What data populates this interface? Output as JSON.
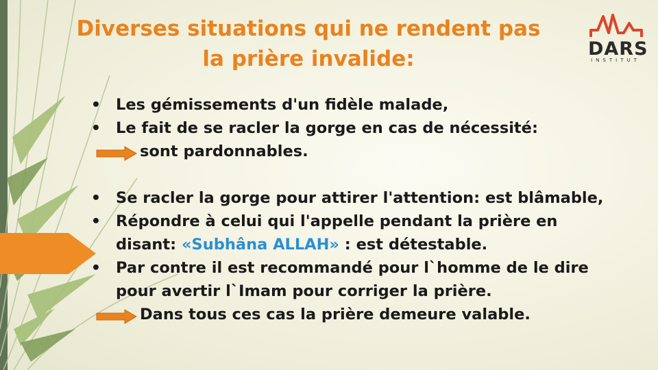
{
  "slide": {
    "title_line1": "Diverses situations qui ne rendent pas",
    "title_line2": "la prière invalide:",
    "logo": {
      "name": "DARS",
      "sub": "INSTITUT"
    },
    "colors": {
      "title": "#e8831f",
      "highlight": "#2a8fd4",
      "arrow": "#e8831f",
      "bar": "#5f7355"
    },
    "bullet_symbol": "•",
    "items": {
      "b1": "Les gémissements d'un fidèle malade,",
      "b2": "Le fait de se racler la gorge en cas de nécessité:",
      "a1": "sont pardonnables.",
      "b3": "Se racler la gorge pour attirer l'attention: est blâmable,",
      "b4_l1": "Répondre à celui qui l'appelle pendant la prière en",
      "b4_l2_pre": "disant: ",
      "b4_l2_hl": "«Subhâna ALLAH»",
      "b4_l2_post": " : est détestable.",
      "b5_l1": "Par contre il est recommandé pour l`homme de le dire",
      "b5_l2": "pour avertir l`Imam pour corriger la prière.",
      "a2": "Dans tous ces cas la prière demeure valable."
    }
  }
}
